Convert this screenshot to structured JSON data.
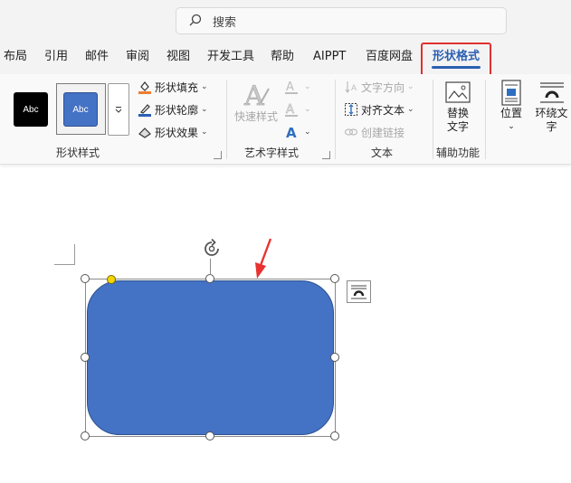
{
  "search": {
    "placeholder": "搜索",
    "icon": "search-icon"
  },
  "tabs": [
    {
      "label": "布局",
      "active": false
    },
    {
      "label": "引用",
      "active": false
    },
    {
      "label": "邮件",
      "active": false
    },
    {
      "label": "审阅",
      "active": false
    },
    {
      "label": "视图",
      "active": false
    },
    {
      "label": "开发工具",
      "active": false
    },
    {
      "label": "帮助",
      "active": false
    },
    {
      "label": "AIPPT",
      "active": false
    },
    {
      "label": "百度网盘",
      "active": false
    },
    {
      "label": "形状格式",
      "active": true
    }
  ],
  "ribbon": {
    "shape_styles": {
      "label": "形状样式",
      "style_black": "Abc",
      "style_blue": "Abc",
      "fill": "形状填充",
      "outline": "形状轮廓",
      "effects": "形状效果"
    },
    "wordart": {
      "label": "艺术字样式",
      "quick_styles": "快速样式"
    },
    "text": {
      "label": "文本",
      "direction": "文字方向",
      "align": "对齐文本",
      "link": "创建链接"
    },
    "accessibility": {
      "label": "辅助功能",
      "alt_text_line1": "替换",
      "alt_text_line2": "文字"
    },
    "arrange": {
      "position": "位置",
      "wrap_line1": "环绕文",
      "wrap_line2": "字"
    }
  },
  "colors": {
    "accent": "#2b5fb2",
    "highlight_border": "#e0312f",
    "shape_fill": "#4472c4",
    "shape_outline": "#2f528f",
    "adjust_handle": "#f2d600"
  }
}
